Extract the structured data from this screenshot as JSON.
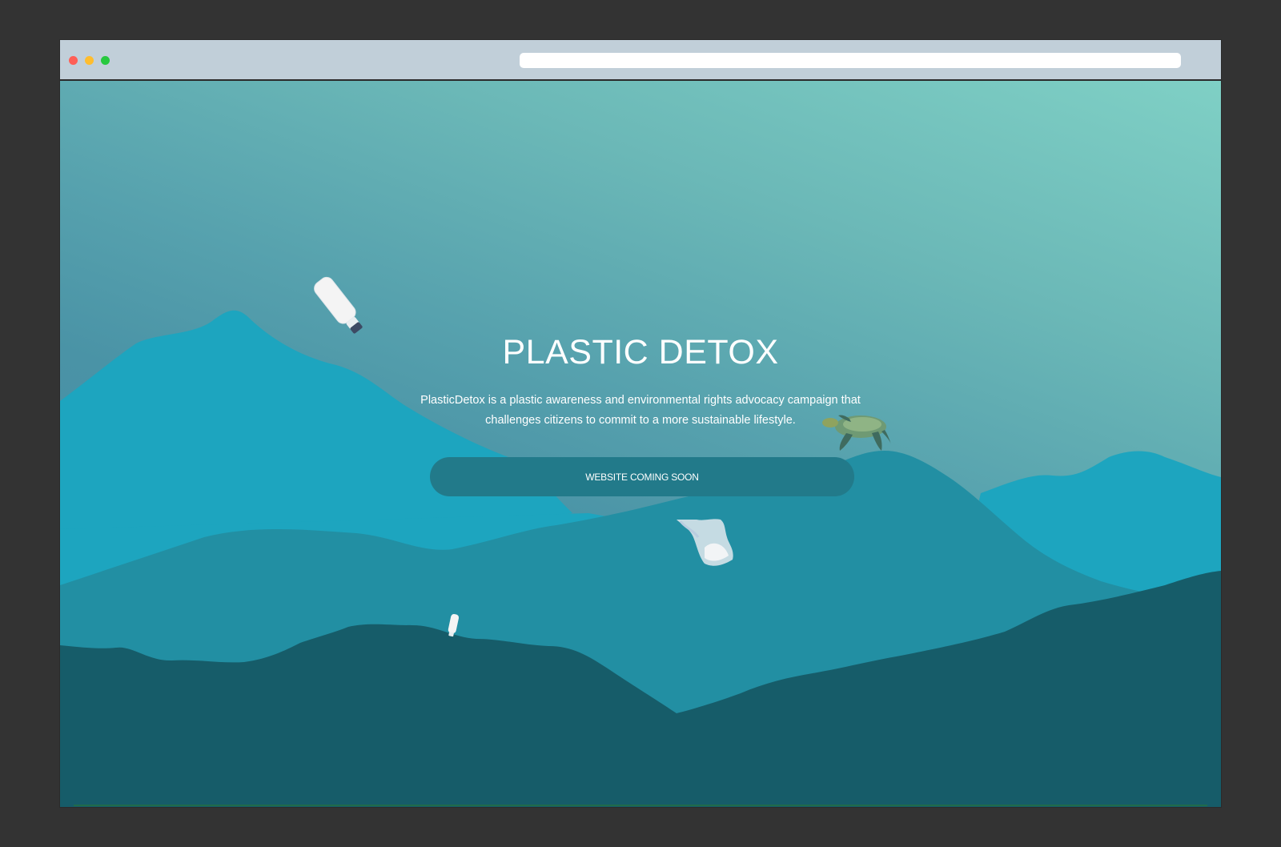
{
  "browser": {
    "url_value": "",
    "colors": {
      "close": "#ff5f56",
      "minimize": "#ffbd2e",
      "maximize": "#27c93f"
    }
  },
  "hero": {
    "title": "PLASTIC DETOX",
    "description": "PlasticDetox is a plastic awareness and environmental rights advocacy campaign that challenges citizens to commit to a more sustainable lifestyle.",
    "button_label": "WEBSITE COMING SOON"
  },
  "illustration": {
    "items": [
      "plastic-bottle-icon",
      "sea-turtle-icon",
      "plastic-bag-icon",
      "small-bottle-icon",
      "mountain-layers"
    ],
    "colors": {
      "sky_top": "#7fd0c5",
      "sky_bottom": "#428aa0",
      "mountain_back": "#1da5bf",
      "mountain_mid": "#228fa3",
      "mountain_front": "#165c69",
      "button_bg": "#227a8a"
    }
  }
}
